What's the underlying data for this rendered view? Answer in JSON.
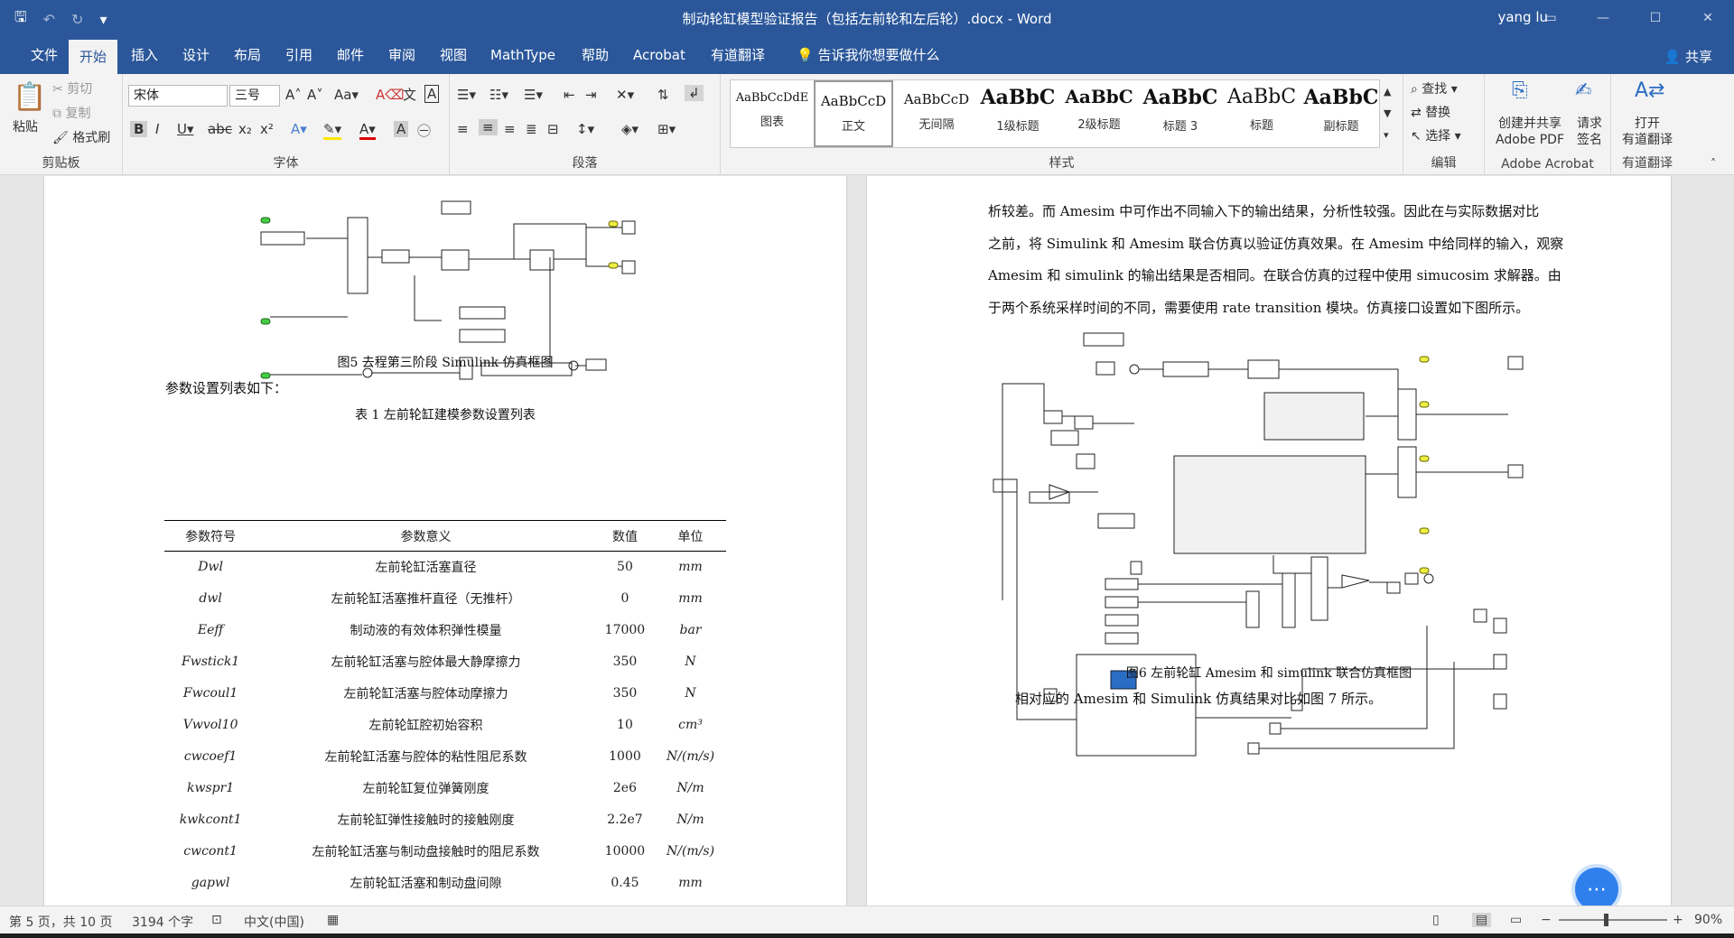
{
  "window": {
    "title": "制动轮缸模型验证报告（包括左前轮和左后轮）.docx - Word",
    "user": "yang lu"
  },
  "menu": {
    "tabs": [
      "文件",
      "开始",
      "插入",
      "设计",
      "布局",
      "引用",
      "邮件",
      "审阅",
      "视图",
      "MathType",
      "帮助",
      "Acrobat",
      "有道翻译"
    ],
    "active_tab": "开始",
    "tellme": "告诉我你想要做什么",
    "share": "共享"
  },
  "ribbon": {
    "clipboard": {
      "paste": "粘贴",
      "cut": "剪切",
      "copy": "复制",
      "format_painter": "格式刷",
      "label": "剪贴板"
    },
    "font": {
      "font_name": "宋体",
      "font_size": "三号",
      "label": "字体"
    },
    "paragraph": {
      "label": "段落"
    },
    "styles": {
      "label": "样式",
      "items": [
        {
          "sample": "AaBbCcDdE",
          "name": "图表"
        },
        {
          "sample": "AaBbCcD",
          "name": "正文"
        },
        {
          "sample": "AaBbCcD",
          "name": "无间隔"
        },
        {
          "sample": "AaBbC",
          "name": "1级标题"
        },
        {
          "sample": "AaBbC",
          "name": "2级标题"
        },
        {
          "sample": "AaBbC",
          "name": "标题 3"
        },
        {
          "sample": "AaBbC",
          "name": "标题"
        },
        {
          "sample": "AaBbC",
          "name": "副标题"
        }
      ]
    },
    "editing": {
      "find": "查找",
      "replace": "替换",
      "select": "选择",
      "label": "编辑"
    },
    "acrobat": {
      "create_share": "创建并共享",
      "create_share2": "Adobe PDF",
      "request": "请求",
      "request2": "签名",
      "label": "Adobe Acrobat"
    },
    "youdao": {
      "open": "打开",
      "open2": "有道翻译",
      "label": "有道翻译"
    }
  },
  "left_page": {
    "figure5_caption": "图5 去程第三阶段 Simulink 仿真框图",
    "intro": "参数设置列表如下：",
    "table_caption": "表 1 左前轮缸建模参数设置列表",
    "table_headers": [
      "参数符号",
      "参数意义",
      "数值",
      "单位"
    ],
    "table_rows": [
      [
        "Dwl",
        "左前轮缸活塞直径",
        "50",
        "mm"
      ],
      [
        "dwl",
        "左前轮缸活塞推杆直径（无推杆）",
        "0",
        "mm"
      ],
      [
        "Eeff",
        "制动液的有效体积弹性模量",
        "17000",
        "bar"
      ],
      [
        "Fwstick1",
        "左前轮缸活塞与腔体最大静摩擦力",
        "350",
        "N"
      ],
      [
        "Fwcoul1",
        "左前轮缸活塞与腔体动摩擦力",
        "350",
        "N"
      ],
      [
        "Vwvol10",
        "左前轮缸腔初始容积",
        "10",
        "cm³"
      ],
      [
        "cwcoef1",
        "左前轮缸活塞与腔体的粘性阻尼系数",
        "1000",
        "N/(m/s)"
      ],
      [
        "kwspr1",
        "左前轮缸复位弹簧刚度",
        "2e6",
        "N/m"
      ],
      [
        "kwkcont1",
        "左前轮缸弹性接触时的接触刚度",
        "2.2e7",
        "N/m"
      ],
      [
        "cwcont1",
        "左前轮缸活塞与制动盘接触时的阻尼系数",
        "10000",
        "N/(m/s)"
      ],
      [
        "gapwl",
        "左前轮缸活塞和制动盘间隙",
        "0.45",
        "mm"
      ]
    ]
  },
  "right_page": {
    "para_lines": [
      "析较差。而 Amesim 中可作出不同输入下的输出结果，分析性较强。因此在与实际数据对比",
      "之前，将 Simulink 和 Amesim 联合仿真以验证仿真效果。在 Amesim 中给同样的输入，观察",
      "Amesim 和 simulink 的输出结果是否相同。在联合仿真的过程中使用 simucosim 求解器。由",
      "于两个系统采样时间的不同，需要使用 rate transition 模块。仿真接口设置如下图所示。"
    ],
    "figure6_caption": "图6 左前轮缸 Amesim 和 simulink 联合仿真框图",
    "after_text": "相对应的 Amesim 和 Simulink 仿真结果对比如图 7 所示。"
  },
  "status": {
    "page": "第 5 页，共 10 页",
    "words": "3194 个字",
    "language": "中文(中国)",
    "zoom": "90%"
  }
}
